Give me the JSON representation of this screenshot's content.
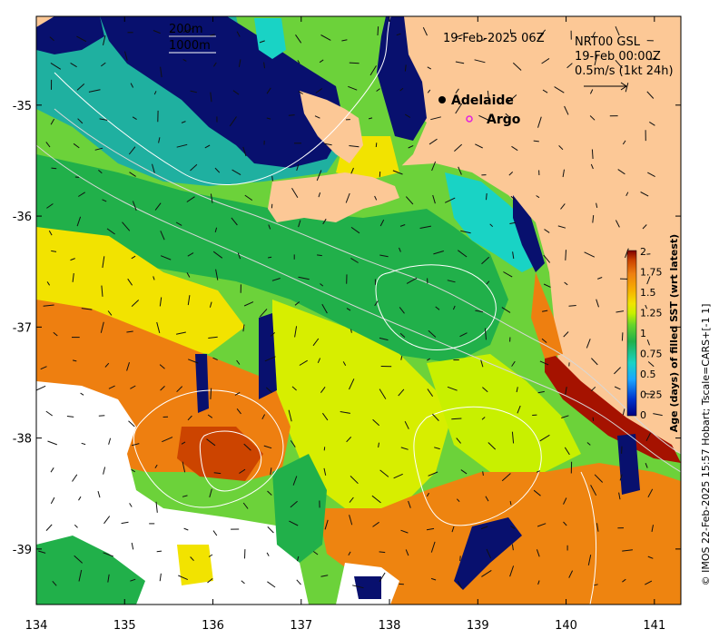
{
  "map": {
    "title": "19-Feb-2025 06Z",
    "product_label": "NRT00 GSL",
    "product_time": "19-Feb 00:00Z",
    "vector_scale_label": "0.5m/s (1kt 24h)",
    "contour_legend": [
      "200m",
      "1000m"
    ],
    "credit": "© IMOS 22-Feb-2025 15:57 Hobart; Tscale=CARS+[-1 1]",
    "x_ticks": [
      "134",
      "135",
      "136",
      "137",
      "138",
      "139",
      "140",
      "141"
    ],
    "y_ticks": [
      "-35",
      "-36",
      "-37",
      "-38",
      "-39"
    ],
    "places": [
      {
        "name": "Adelaide",
        "marker": "filled-dot",
        "lon": 138.6,
        "lat": -34.93
      },
      {
        "name": "Argo",
        "marker": "magenta-ring",
        "lon": 138.87,
        "lat": -35.1
      }
    ],
    "extent": {
      "lon": [
        134,
        141.3
      ],
      "lat": [
        -39.5,
        -34.2
      ]
    }
  },
  "colorbar": {
    "label": "Age (days) of filled SST (wrt latest)",
    "ticks": [
      "2",
      "1.75",
      "1.5",
      "1.25",
      "1",
      "0.75",
      "0.5",
      "0.25",
      "0"
    ],
    "range": [
      0,
      2
    ],
    "colors": [
      "#00007f",
      "#0033cc",
      "#1aa6ff",
      "#19d3c5",
      "#21b04a",
      "#67d42b",
      "#c8f000",
      "#f2e300",
      "#f7b000",
      "#ee7f10",
      "#cc4400",
      "#7f0000"
    ]
  },
  "colors": {
    "land": "#fcc896",
    "missing": "#ffffff"
  }
}
